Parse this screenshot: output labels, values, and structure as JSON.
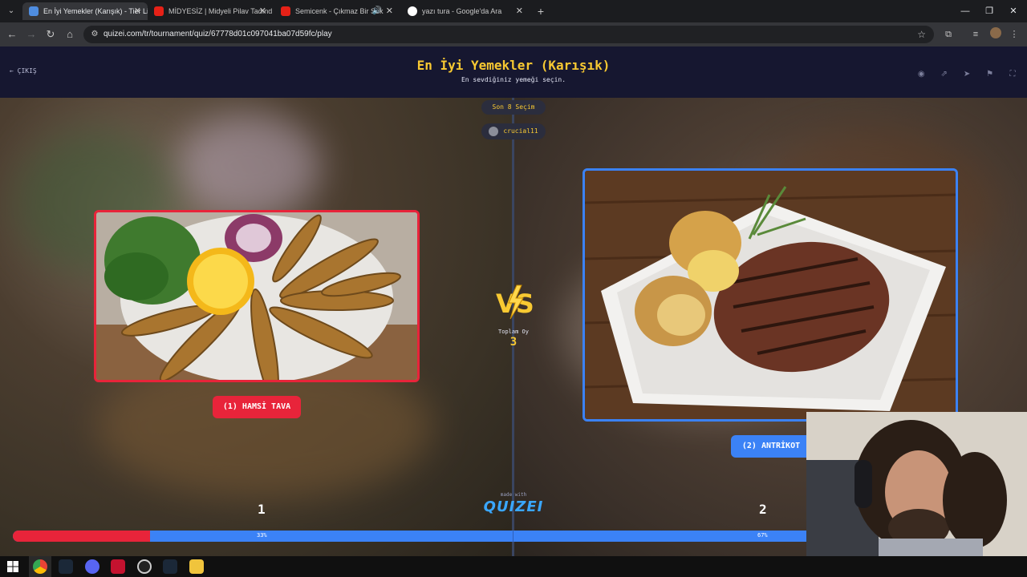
{
  "browser": {
    "tabs": [
      {
        "title": "En İyi Yemekler (Karışık) - Tier Li",
        "favicon_color": "#4f8de0",
        "active": true
      },
      {
        "title": "MİDYESİZ | Midyeli Pilav Tadınd",
        "favicon_color": "#e62117",
        "active": false
      },
      {
        "title": "Semicenk - Çıkmaz Bir Sok",
        "favicon_color": "#e62117",
        "active": false,
        "playing_audio": true
      },
      {
        "title": "yazı tura - Google'da Ara",
        "favicon_color": "#ffffff",
        "active": false
      }
    ],
    "url": "quizei.com/tr/tournament/quiz/67778d01c097041ba07d59fc/play"
  },
  "quiz": {
    "exit_label": "ÇIKIŞ",
    "title": "En İyi Yemekler (Karışık)",
    "subtitle": "En sevdiğiniz yemeği seçin.",
    "round_label": "Son 8 Seçim",
    "username": "crucial11",
    "total_votes_label": "Toplam Oy",
    "total_votes": "3",
    "vs_label": "VS",
    "made_with": "made with",
    "brand": "QUIZEI"
  },
  "choices": {
    "left": {
      "button_label": "(1) HAMSİ TAVA",
      "score": "1",
      "percent_label": "33%",
      "percent": 33.33,
      "accent": "#e8243a"
    },
    "right": {
      "button_label": "(2) ANTRİKOT",
      "score": "2",
      "percent_label": "67%",
      "percent": 66.67,
      "accent": "#3b82f6"
    }
  },
  "colors": {
    "accent_yellow": "#f8c932",
    "red": "#e8243a",
    "blue": "#3b82f6",
    "page_bg": "#15162a"
  }
}
